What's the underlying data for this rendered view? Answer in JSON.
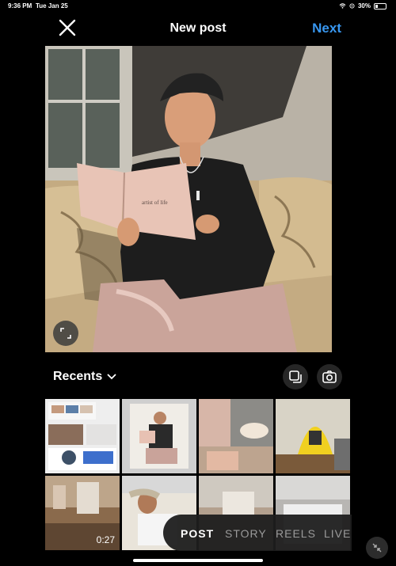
{
  "status_bar": {
    "time": "9:36 PM",
    "date": "Tue Jan 25",
    "battery": "30%",
    "icons": [
      "wifi-icon",
      "location-icon",
      "battery-icon"
    ]
  },
  "header": {
    "title": "New post",
    "next_label": "Next",
    "accent_color": "#3897f0",
    "close_icon": "close-icon"
  },
  "preview": {
    "book_title": "artist of life"
  },
  "gallery": {
    "album_label": "Recents",
    "album_icon": "chevron-down-icon",
    "multi_select_icon": "multi-select-icon",
    "camera_icon": "camera-icon",
    "thumbnails": [
      {
        "kind": "screenshot"
      },
      {
        "kind": "photo",
        "selected": true
      },
      {
        "kind": "photo"
      },
      {
        "kind": "photo"
      },
      {
        "kind": "video",
        "duration": "0:27"
      },
      {
        "kind": "photo"
      },
      {
        "kind": "photo"
      },
      {
        "kind": "photo"
      }
    ]
  },
  "modes": {
    "items": [
      "POST",
      "STORY",
      "REELS",
      "LIVE"
    ],
    "active": "POST"
  }
}
